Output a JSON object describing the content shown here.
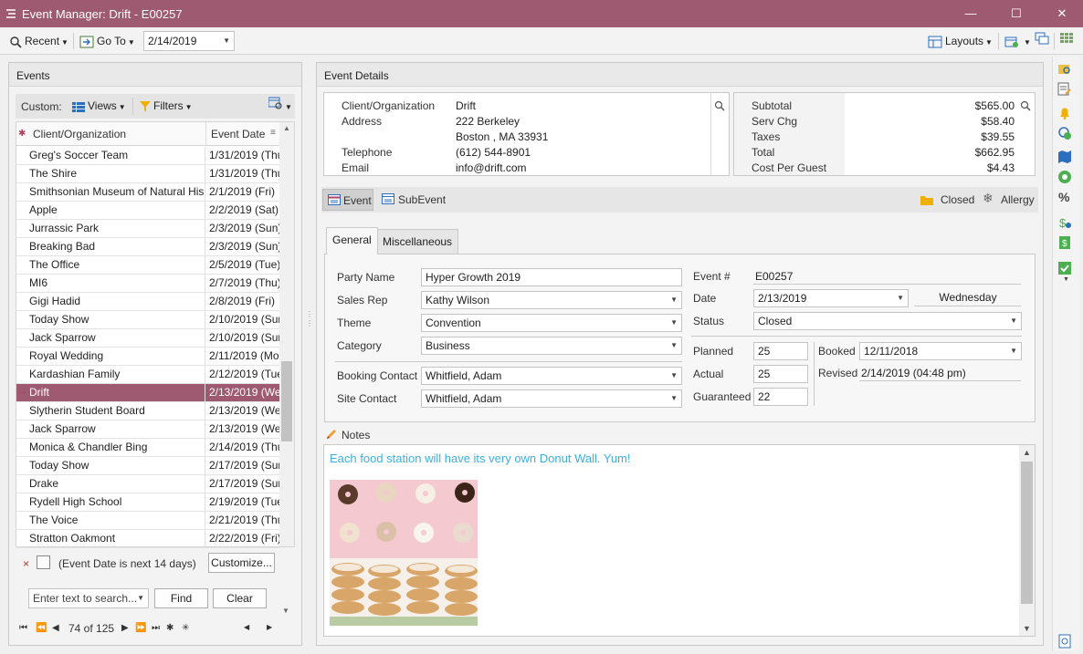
{
  "window": {
    "title": "Event Manager: Drift - E00257"
  },
  "toolbar": {
    "recent": "Recent",
    "goto": "Go To",
    "date": "2/14/2019",
    "layouts": "Layouts"
  },
  "events_panel": {
    "title": "Events",
    "custom": "Custom:",
    "views": "Views",
    "filters": "Filters",
    "col_client": "Client/Organization",
    "col_date": "Event Date",
    "rows": [
      {
        "client": "Greg's Soccer Team",
        "date": "1/31/2019 (Thu"
      },
      {
        "client": "The Shire",
        "date": "1/31/2019 (Thu"
      },
      {
        "client": "Smithsonian Museum of Natural His",
        "date": "2/1/2019 (Fri)"
      },
      {
        "client": "Apple",
        "date": "2/2/2019 (Sat)"
      },
      {
        "client": "Jurrassic Park",
        "date": "2/3/2019 (Sun)"
      },
      {
        "client": "Breaking Bad",
        "date": "2/3/2019 (Sun)"
      },
      {
        "client": "The Office",
        "date": "2/5/2019 (Tue)"
      },
      {
        "client": "MI6",
        "date": "2/7/2019 (Thu)"
      },
      {
        "client": "Gigi Hadid",
        "date": "2/8/2019 (Fri)"
      },
      {
        "client": "Today Show",
        "date": "2/10/2019 (Sun"
      },
      {
        "client": "Jack Sparrow",
        "date": "2/10/2019 (Sun"
      },
      {
        "client": "Royal Wedding",
        "date": "2/11/2019 (Mo"
      },
      {
        "client": "Kardashian Family",
        "date": "2/12/2019 (Tue"
      },
      {
        "client": "Drift",
        "date": "2/13/2019 (We"
      },
      {
        "client": "Slytherin Student Board",
        "date": "2/13/2019 (We"
      },
      {
        "client": "Jack Sparrow",
        "date": "2/13/2019 (We"
      },
      {
        "client": "Monica & Chandler Bing",
        "date": "2/14/2019 (Thu"
      },
      {
        "client": "Today Show",
        "date": "2/17/2019 (Sun"
      },
      {
        "client": "Drake",
        "date": "2/17/2019 (Sun"
      },
      {
        "client": "Rydell High School",
        "date": "2/19/2019 (Tue"
      },
      {
        "client": "The Voice",
        "date": "2/21/2019 (Thu"
      },
      {
        "client": "Stratton Oakmont",
        "date": "2/22/2019 (Fri)"
      }
    ],
    "filter_text": "(Event Date is next 14 days)",
    "customize": "Customize...",
    "search_placeholder": "Enter text to search...",
    "find": "Find",
    "clear": "Clear",
    "record_count": "74 of 125"
  },
  "details": {
    "title": "Event Details",
    "client_label": "Client/Organization",
    "client": "Drift",
    "address_label": "Address",
    "address1": "222 Berkeley",
    "address2": "Boston , MA 33931",
    "telephone_label": "Telephone",
    "telephone": "(612) 544-8901",
    "email_label": "Email",
    "email": "info@drift.com",
    "subtotal_label": "Subtotal",
    "subtotal": "$565.00",
    "servchg_label": "Serv Chg",
    "servchg": "$58.40",
    "taxes_label": "Taxes",
    "taxes": "$39.55",
    "total_label": "Total",
    "total": "$662.95",
    "cpg_label": "Cost Per Guest",
    "cpg": "$4.43",
    "event_btn": "Event",
    "subevent_btn": "SubEvent",
    "closed": "Closed",
    "allergy": "Allergy",
    "tab_general": "General",
    "tab_misc": "Miscellaneous",
    "party_name_label": "Party Name",
    "party_name": "Hyper Growth 2019",
    "sales_rep_label": "Sales Rep",
    "sales_rep": "Kathy Wilson",
    "theme_label": "Theme",
    "theme": "Convention",
    "category_label": "Category",
    "category": "Business",
    "booking_contact_label": "Booking Contact",
    "booking_contact": "Whitfield, Adam",
    "site_contact_label": "Site Contact",
    "site_contact": "Whitfield, Adam",
    "event_no_label": "Event #",
    "event_no": "E00257",
    "date_label": "Date",
    "date": "2/13/2019",
    "weekday": "Wednesday",
    "status_label": "Status",
    "status": "Closed",
    "planned_label": "Planned",
    "planned": "25",
    "actual_label": "Actual",
    "actual": "25",
    "guaranteed_label": "Guaranteed",
    "guaranteed": "22",
    "booked_label": "Booked",
    "booked": "12/11/2018",
    "revised_label": "Revised",
    "revised": "2/14/2019 (04:48 pm)",
    "notes_label": "Notes",
    "notes_text": "Each food station will have its very own Donut Wall. Yum!"
  },
  "colors": {
    "accent": "#9d5a70",
    "notes_text": "#3bb0e0"
  }
}
